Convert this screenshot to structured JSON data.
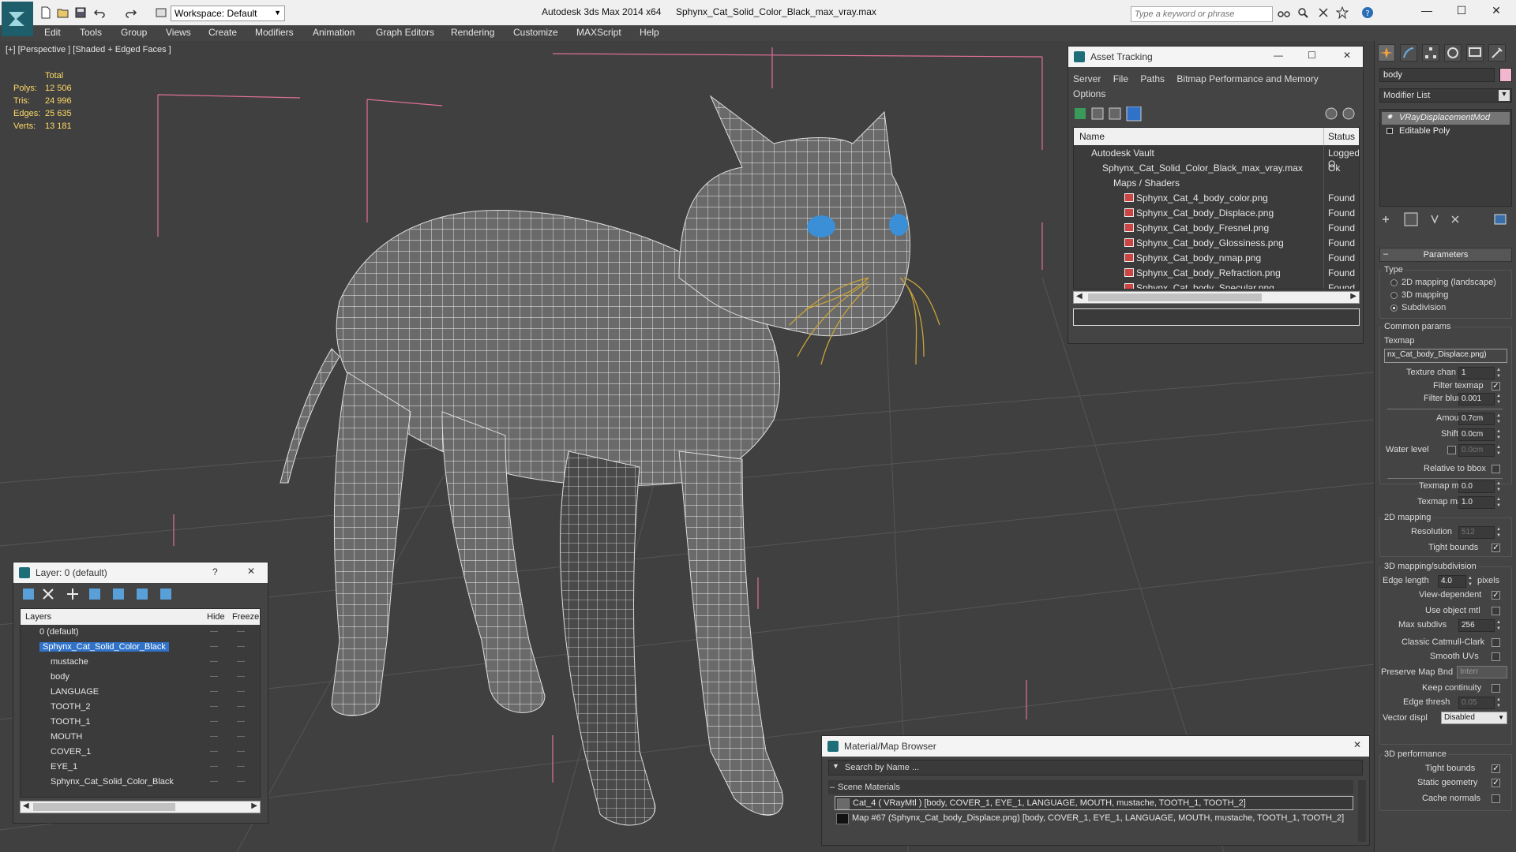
{
  "titlebar": {
    "workspace_label": "Workspace: Default",
    "app_title": "Autodesk 3ds Max  2014 x64",
    "file_name": "Sphynx_Cat_Solid_Color_Black_max_vray.max",
    "search_placeholder": "Type a keyword or phrase"
  },
  "menu": [
    "Edit",
    "Tools",
    "Group",
    "Views",
    "Create",
    "Modifiers",
    "Animation",
    "Graph Editors",
    "Rendering",
    "Customize",
    "MAXScript",
    "Help"
  ],
  "viewport": {
    "label": "[+] [Perspective ] [Shaded + Edged Faces ]",
    "stats_header": "Total",
    "stats": [
      {
        "label": "Polys:",
        "value": "12 506"
      },
      {
        "label": "Tris:",
        "value": "24 996"
      },
      {
        "label": "Edges:",
        "value": "25 635"
      },
      {
        "label": "Verts:",
        "value": "13 181"
      }
    ]
  },
  "asset_tracking": {
    "title": "Asset Tracking",
    "menu": [
      "Server",
      "File",
      "Paths",
      "Bitmap Performance and Memory",
      "Options"
    ],
    "col_name": "Name",
    "col_status": "Status",
    "rows": [
      {
        "name": "Autodesk Vault",
        "status": "Logged O",
        "indent": 1
      },
      {
        "name": "Sphynx_Cat_Solid_Color_Black_max_vray.max",
        "status": "Ok",
        "indent": 2
      },
      {
        "name": "Maps / Shaders",
        "status": "",
        "indent": 3
      },
      {
        "name": "Sphynx_Cat_4_body_color.png",
        "status": "Found",
        "indent": 4
      },
      {
        "name": "Sphynx_Cat_body_Displace.png",
        "status": "Found",
        "indent": 4
      },
      {
        "name": "Sphynx_Cat_body_Fresnel.png",
        "status": "Found",
        "indent": 4
      },
      {
        "name": "Sphynx_Cat_body_Glossiness.png",
        "status": "Found",
        "indent": 4
      },
      {
        "name": "Sphynx_Cat_body_nmap.png",
        "status": "Found",
        "indent": 4
      },
      {
        "name": "Sphynx_Cat_body_Refraction.png",
        "status": "Found",
        "indent": 4
      },
      {
        "name": "Sphynx_Cat_body_Specular.png",
        "status": "Found",
        "indent": 4
      }
    ]
  },
  "layer_panel": {
    "title": "Layer: 0 (default)",
    "help": "?",
    "col_layers": "Layers",
    "col_hide": "Hide",
    "col_freeze": "Freeze",
    "rows": [
      {
        "name": "0 (default)",
        "indent": 1
      },
      {
        "name": "Sphynx_Cat_Solid_Color_Black",
        "indent": 1,
        "selected": true
      },
      {
        "name": "mustache",
        "indent": 2
      },
      {
        "name": "body",
        "indent": 2
      },
      {
        "name": "LANGUAGE",
        "indent": 2
      },
      {
        "name": "TOOTH_2",
        "indent": 2
      },
      {
        "name": "TOOTH_1",
        "indent": 2
      },
      {
        "name": "MOUTH",
        "indent": 2
      },
      {
        "name": "COVER_1",
        "indent": 2
      },
      {
        "name": "EYE_1",
        "indent": 2
      },
      {
        "name": "Sphynx_Cat_Solid_Color_Black",
        "indent": 2
      }
    ]
  },
  "material_browser": {
    "title": "Material/Map Browser",
    "search_placeholder": "Search by Name ...",
    "group": "Scene Materials",
    "rows": [
      "Cat_4  ( VRayMtl )  [body, COVER_1, EYE_1, LANGUAGE, MOUTH, mustache, TOOTH_1, TOOTH_2]",
      "Map #67 (Sphynx_Cat_body_Displace.png)  [body, COVER_1, EYE_1, LANGUAGE, MOUTH, mustache, TOOTH_1, TOOTH_2]"
    ]
  },
  "command_panel": {
    "object_name": "body",
    "object_color": "#f3b6cf",
    "modifier_list": "Modifier List",
    "stack": [
      "VRayDisplacementMod",
      "Editable Poly"
    ],
    "rollout_title": "Parameters",
    "type_label": "Type",
    "type_options": [
      "2D mapping (landscape)",
      "3D mapping",
      "Subdivision"
    ],
    "type_selected": "Subdivision",
    "common_params": "Common params",
    "texmap_label": "Texmap",
    "texmap_value": "nx_Cat_body_Displace.png)",
    "texture_chan_label": "Texture chan",
    "texture_chan_value": "1",
    "filter_texmap_label": "Filter texmap",
    "filter_blur_label": "Filter blur",
    "filter_blur_value": "0.001",
    "amount_label": "Amount",
    "amount_value": "0.7cm",
    "shift_label": "Shift",
    "shift_value": "0.0cm",
    "water_level_label": "Water level",
    "water_level_value": "0.0cm",
    "relative_bbox_label": "Relative to bbox",
    "texmap_min_label": "Texmap min",
    "texmap_min_value": "0.0",
    "texmap_max_label": "Texmap max",
    "texmap_max_value": "1.0",
    "mapping2d_title": "2D mapping",
    "resolution_label": "Resolution",
    "resolution_value": "512",
    "tight_bounds_label": "Tight bounds",
    "mapping3d_title": "3D mapping/subdivision",
    "edge_length_label": "Edge length",
    "edge_length_value": "4.0",
    "pixels_label": "pixels",
    "view_dependent_label": "View-dependent",
    "use_object_mtl_label": "Use object mtl",
    "max_subdivs_label": "Max subdivs",
    "max_subdivs_value": "256",
    "classic_cc_label": "Classic Catmull-Clark",
    "smooth_uvs_label": "Smooth UVs",
    "preserve_map_label": "Preserve Map Bnd",
    "preserve_map_value": "Interr",
    "keep_continuity_label": "Keep continuity",
    "edge_thresh_label": "Edge thresh",
    "edge_thresh_value": "0.05",
    "vector_displ_label": "Vector displ",
    "vector_displ_value": "Disabled",
    "perf_title": "3D performance",
    "perf_tight_bounds_label": "Tight bounds",
    "static_geometry_label": "Static geometry",
    "cache_normals_label": "Cache normals"
  },
  "colors": {
    "accent": "#2f72c8",
    "stats": "#ffd966",
    "viewport_bg": "#404040",
    "whisker": "#c8a33a",
    "eye": "#3b8fd6"
  }
}
